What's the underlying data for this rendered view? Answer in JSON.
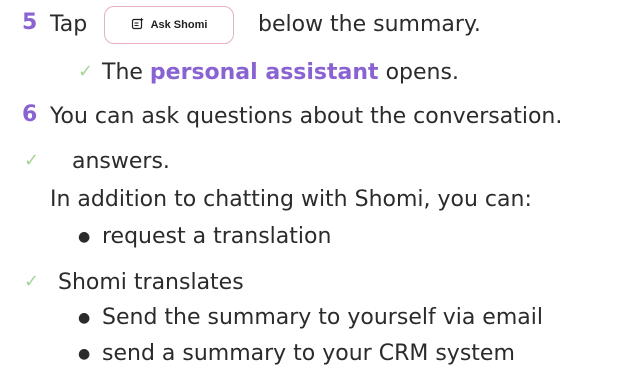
{
  "steps": [
    {
      "number": "5",
      "before": "Tap",
      "after": "below the summary."
    },
    {
      "number": "6",
      "text": "You can ask questions about the conversation."
    }
  ],
  "button": {
    "label": "Ask Shomi",
    "icon": "chat-sparkle-icon"
  },
  "result_1": {
    "before": "The",
    "highlight": "personal assistant",
    "after": "opens."
  },
  "answers_text": "answers.",
  "intro_text": "In addition to chatting with Shomi, you can:",
  "option_1": "request a translation",
  "result_2": "Shomi translates",
  "option_2": "Send the summary to yourself via email",
  "option_3": "send a summary to your CRM system",
  "check_glyph": "✓",
  "bullet_glyph": "●",
  "colors": {
    "accent": "#8a63d2",
    "check": "#a5d39a",
    "button_border": "#e6b0c8"
  }
}
